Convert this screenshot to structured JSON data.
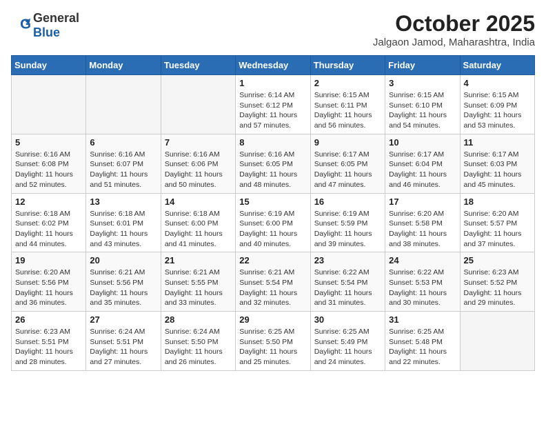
{
  "logo": {
    "general": "General",
    "blue": "Blue"
  },
  "header": {
    "month_year": "October 2025",
    "location": "Jalgaon Jamod, Maharashtra, India"
  },
  "days_of_week": [
    "Sunday",
    "Monday",
    "Tuesday",
    "Wednesday",
    "Thursday",
    "Friday",
    "Saturday"
  ],
  "weeks": [
    [
      {
        "day": "",
        "info": ""
      },
      {
        "day": "",
        "info": ""
      },
      {
        "day": "",
        "info": ""
      },
      {
        "day": "1",
        "info": "Sunrise: 6:14 AM\nSunset: 6:12 PM\nDaylight: 11 hours and 57 minutes."
      },
      {
        "day": "2",
        "info": "Sunrise: 6:15 AM\nSunset: 6:11 PM\nDaylight: 11 hours and 56 minutes."
      },
      {
        "day": "3",
        "info": "Sunrise: 6:15 AM\nSunset: 6:10 PM\nDaylight: 11 hours and 54 minutes."
      },
      {
        "day": "4",
        "info": "Sunrise: 6:15 AM\nSunset: 6:09 PM\nDaylight: 11 hours and 53 minutes."
      }
    ],
    [
      {
        "day": "5",
        "info": "Sunrise: 6:16 AM\nSunset: 6:08 PM\nDaylight: 11 hours and 52 minutes."
      },
      {
        "day": "6",
        "info": "Sunrise: 6:16 AM\nSunset: 6:07 PM\nDaylight: 11 hours and 51 minutes."
      },
      {
        "day": "7",
        "info": "Sunrise: 6:16 AM\nSunset: 6:06 PM\nDaylight: 11 hours and 50 minutes."
      },
      {
        "day": "8",
        "info": "Sunrise: 6:16 AM\nSunset: 6:05 PM\nDaylight: 11 hours and 48 minutes."
      },
      {
        "day": "9",
        "info": "Sunrise: 6:17 AM\nSunset: 6:05 PM\nDaylight: 11 hours and 47 minutes."
      },
      {
        "day": "10",
        "info": "Sunrise: 6:17 AM\nSunset: 6:04 PM\nDaylight: 11 hours and 46 minutes."
      },
      {
        "day": "11",
        "info": "Sunrise: 6:17 AM\nSunset: 6:03 PM\nDaylight: 11 hours and 45 minutes."
      }
    ],
    [
      {
        "day": "12",
        "info": "Sunrise: 6:18 AM\nSunset: 6:02 PM\nDaylight: 11 hours and 44 minutes."
      },
      {
        "day": "13",
        "info": "Sunrise: 6:18 AM\nSunset: 6:01 PM\nDaylight: 11 hours and 43 minutes."
      },
      {
        "day": "14",
        "info": "Sunrise: 6:18 AM\nSunset: 6:00 PM\nDaylight: 11 hours and 41 minutes."
      },
      {
        "day": "15",
        "info": "Sunrise: 6:19 AM\nSunset: 6:00 PM\nDaylight: 11 hours and 40 minutes."
      },
      {
        "day": "16",
        "info": "Sunrise: 6:19 AM\nSunset: 5:59 PM\nDaylight: 11 hours and 39 minutes."
      },
      {
        "day": "17",
        "info": "Sunrise: 6:20 AM\nSunset: 5:58 PM\nDaylight: 11 hours and 38 minutes."
      },
      {
        "day": "18",
        "info": "Sunrise: 6:20 AM\nSunset: 5:57 PM\nDaylight: 11 hours and 37 minutes."
      }
    ],
    [
      {
        "day": "19",
        "info": "Sunrise: 6:20 AM\nSunset: 5:56 PM\nDaylight: 11 hours and 36 minutes."
      },
      {
        "day": "20",
        "info": "Sunrise: 6:21 AM\nSunset: 5:56 PM\nDaylight: 11 hours and 35 minutes."
      },
      {
        "day": "21",
        "info": "Sunrise: 6:21 AM\nSunset: 5:55 PM\nDaylight: 11 hours and 33 minutes."
      },
      {
        "day": "22",
        "info": "Sunrise: 6:21 AM\nSunset: 5:54 PM\nDaylight: 11 hours and 32 minutes."
      },
      {
        "day": "23",
        "info": "Sunrise: 6:22 AM\nSunset: 5:54 PM\nDaylight: 11 hours and 31 minutes."
      },
      {
        "day": "24",
        "info": "Sunrise: 6:22 AM\nSunset: 5:53 PM\nDaylight: 11 hours and 30 minutes."
      },
      {
        "day": "25",
        "info": "Sunrise: 6:23 AM\nSunset: 5:52 PM\nDaylight: 11 hours and 29 minutes."
      }
    ],
    [
      {
        "day": "26",
        "info": "Sunrise: 6:23 AM\nSunset: 5:51 PM\nDaylight: 11 hours and 28 minutes."
      },
      {
        "day": "27",
        "info": "Sunrise: 6:24 AM\nSunset: 5:51 PM\nDaylight: 11 hours and 27 minutes."
      },
      {
        "day": "28",
        "info": "Sunrise: 6:24 AM\nSunset: 5:50 PM\nDaylight: 11 hours and 26 minutes."
      },
      {
        "day": "29",
        "info": "Sunrise: 6:25 AM\nSunset: 5:50 PM\nDaylight: 11 hours and 25 minutes."
      },
      {
        "day": "30",
        "info": "Sunrise: 6:25 AM\nSunset: 5:49 PM\nDaylight: 11 hours and 24 minutes."
      },
      {
        "day": "31",
        "info": "Sunrise: 6:25 AM\nSunset: 5:48 PM\nDaylight: 11 hours and 22 minutes."
      },
      {
        "day": "",
        "info": ""
      }
    ]
  ]
}
